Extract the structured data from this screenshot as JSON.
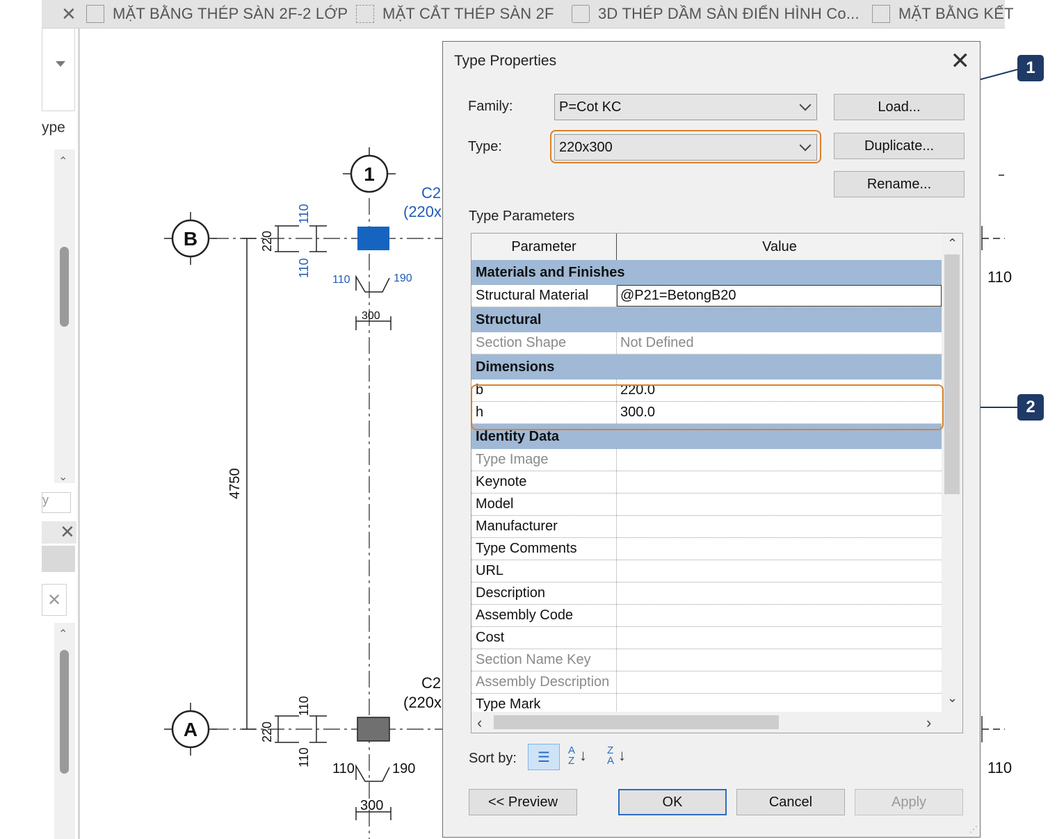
{
  "tabs": [
    {
      "label": "MẶT BẰNG THÉP SÀN 2F-2 LỚP",
      "icon": "sheet-icon"
    },
    {
      "label": "MẶT CẮT THÉP SÀN 2F",
      "icon": "section-icon"
    },
    {
      "label": "3D THÉP DẦM SÀN ĐIỂN HÌNH Co...",
      "icon": "3d-house-icon"
    },
    {
      "label": "MẶT BẰNG KẾT",
      "icon": "sheet-icon"
    }
  ],
  "left_panel": {
    "type_label": "ype",
    "filter_label": "y"
  },
  "drawing": {
    "grid_1": "1",
    "grid_b": "B",
    "grid_a": "A",
    "col_mark_top": "C2",
    "col_size_top": "(220x",
    "col_mark_bot": "C2",
    "col_size_bot": "(220x",
    "dim_110_a": "110",
    "dim_220_a": "220",
    "dim_110_b": "110",
    "dim_110_c": "110",
    "dim_190_a": "190",
    "dim_300_a": "300",
    "dim_4750": "4750",
    "dim_110_d": "110",
    "dim_220_b": "220",
    "dim_110_e": "110",
    "dim_110_f": "110",
    "dim_190_b": "190",
    "dim_300_b": "300",
    "right_110_a": "110",
    "right_110_b": "110"
  },
  "dialog": {
    "title": "Type Properties",
    "family_label": "Family:",
    "family_value": "P=Cot KC",
    "type_label": "Type:",
    "type_value": "220x300",
    "load_button": "Load...",
    "duplicate_button": "Duplicate...",
    "rename_button": "Rename...",
    "type_parameters_label": "Type Parameters",
    "col_parameter": "Parameter",
    "col_value": "Value",
    "sort_by_label": "Sort by:",
    "preview_button": "<< Preview",
    "ok_button": "OK",
    "cancel_button": "Cancel",
    "apply_button": "Apply"
  },
  "parameters": [
    {
      "group": "Materials and Finishes"
    },
    {
      "name": "Structural Material",
      "value": "@P21=BetongB20",
      "editable": true
    },
    {
      "group": "Structural"
    },
    {
      "name": "Section Shape",
      "value": "Not Defined",
      "dim": true
    },
    {
      "group": "Dimensions"
    },
    {
      "name": "b",
      "value": "220.0"
    },
    {
      "name": "h",
      "value": "300.0"
    },
    {
      "group": "Identity Data"
    },
    {
      "name": "Type Image",
      "value": "",
      "dim": true
    },
    {
      "name": "Keynote",
      "value": ""
    },
    {
      "name": "Model",
      "value": ""
    },
    {
      "name": "Manufacturer",
      "value": ""
    },
    {
      "name": "Type Comments",
      "value": ""
    },
    {
      "name": "URL",
      "value": ""
    },
    {
      "name": "Description",
      "value": ""
    },
    {
      "name": "Assembly Code",
      "value": ""
    },
    {
      "name": "Cost",
      "value": ""
    },
    {
      "name": "Section Name Key",
      "value": "",
      "dim": true
    },
    {
      "name": "Assembly Description",
      "value": "",
      "dim": true
    },
    {
      "name": "Type Mark",
      "value": ""
    }
  ],
  "callouts": {
    "one": "1",
    "two": "2"
  },
  "colors": {
    "highlight": "#d9822b",
    "callout": "#1f3a66",
    "group_row": "#9fb9d6",
    "column_selected": "#1565c0"
  }
}
